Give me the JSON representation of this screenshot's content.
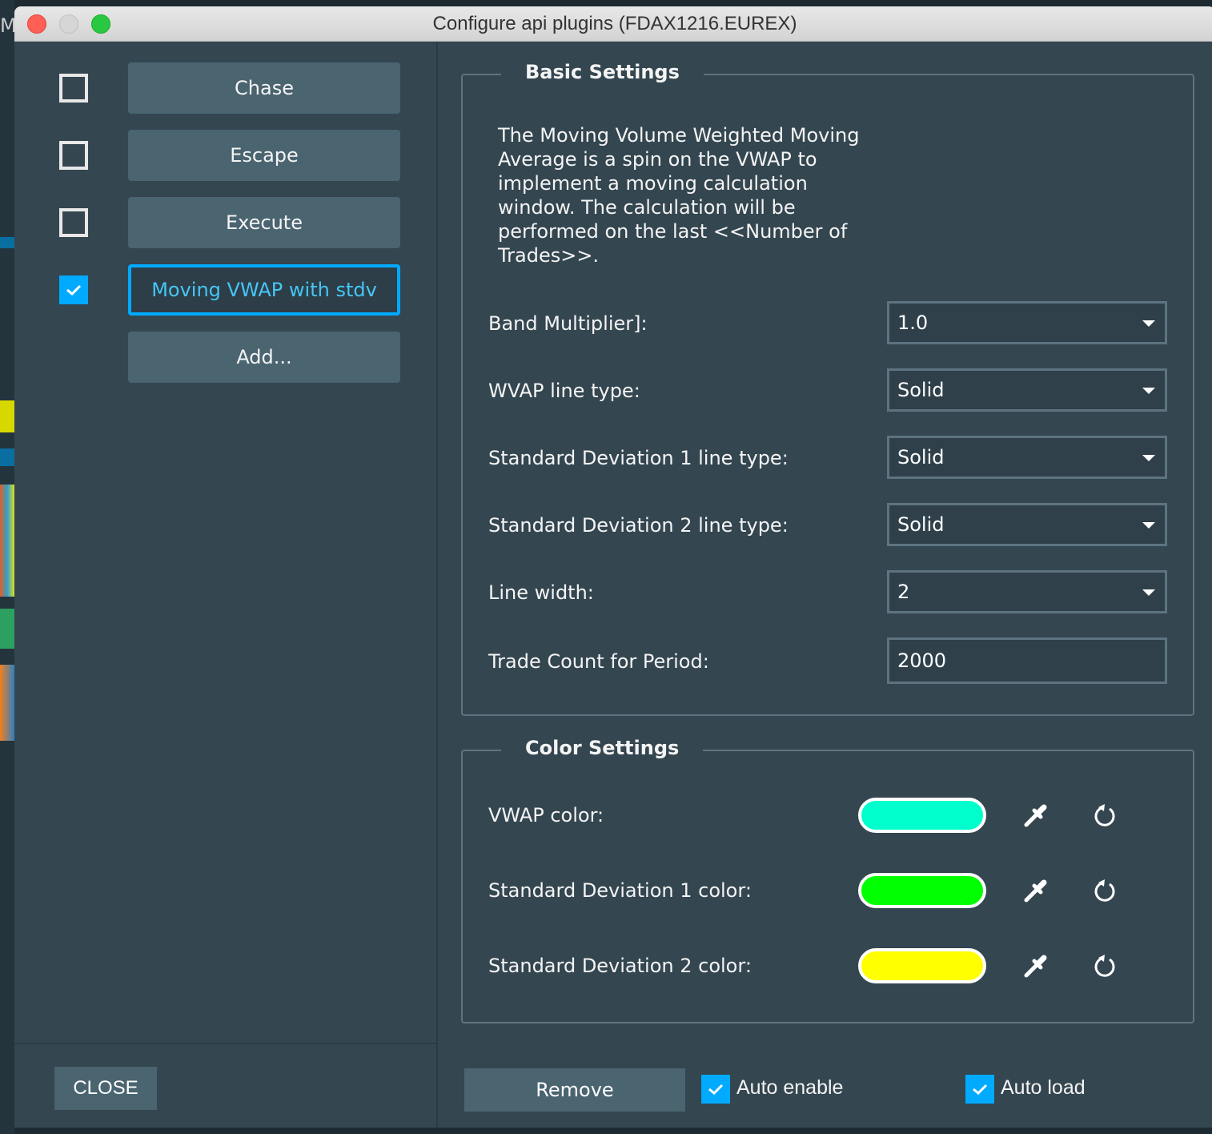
{
  "window": {
    "title": "Configure api plugins (FDAX1216.EUREX)"
  },
  "plugins": [
    {
      "label": "Chase",
      "enabled": false,
      "selected": false
    },
    {
      "label": "Escape",
      "enabled": false,
      "selected": false
    },
    {
      "label": "Execute",
      "enabled": false,
      "selected": false
    },
    {
      "label": "Moving VWAP with stdv",
      "enabled": true,
      "selected": true
    }
  ],
  "add_label": "Add...",
  "close_label": "CLOSE",
  "basic": {
    "title": "Basic Settings",
    "description": "The Moving Volume Weighted Moving Average is a spin on the VWAP to implement a moving calculation window. The calculation will be performed on the last <<Number of Trades>>.",
    "fields": [
      {
        "label": "Band Multiplier]:",
        "value": "1.0",
        "type": "dropdown"
      },
      {
        "label": "WVAP line type:",
        "value": "Solid",
        "type": "dropdown"
      },
      {
        "label": "Standard Deviation 1 line type:",
        "value": "Solid",
        "type": "dropdown"
      },
      {
        "label": "Standard Deviation 2 line type:",
        "value": "Solid",
        "type": "dropdown"
      },
      {
        "label": "Line width:",
        "value": "2",
        "type": "dropdown"
      },
      {
        "label": "Trade Count for Period:",
        "value": "2000",
        "type": "text"
      }
    ]
  },
  "colors": {
    "title": "Color Settings",
    "items": [
      {
        "label": "VWAP color:",
        "color": "#00ffcc"
      },
      {
        "label": "Standard Deviation 1 color:",
        "color": "#00ff00"
      },
      {
        "label": "Standard Deviation 2 color:",
        "color": "#ffff00"
      }
    ],
    "picker_icon": "eyedropper-icon",
    "reset_icon": "reset-icon"
  },
  "footer": {
    "remove_label": "Remove",
    "auto_enable_label": "Auto enable",
    "auto_enable": true,
    "auto_load_label": "Auto load",
    "auto_load": true
  },
  "accent": "#00aaff"
}
